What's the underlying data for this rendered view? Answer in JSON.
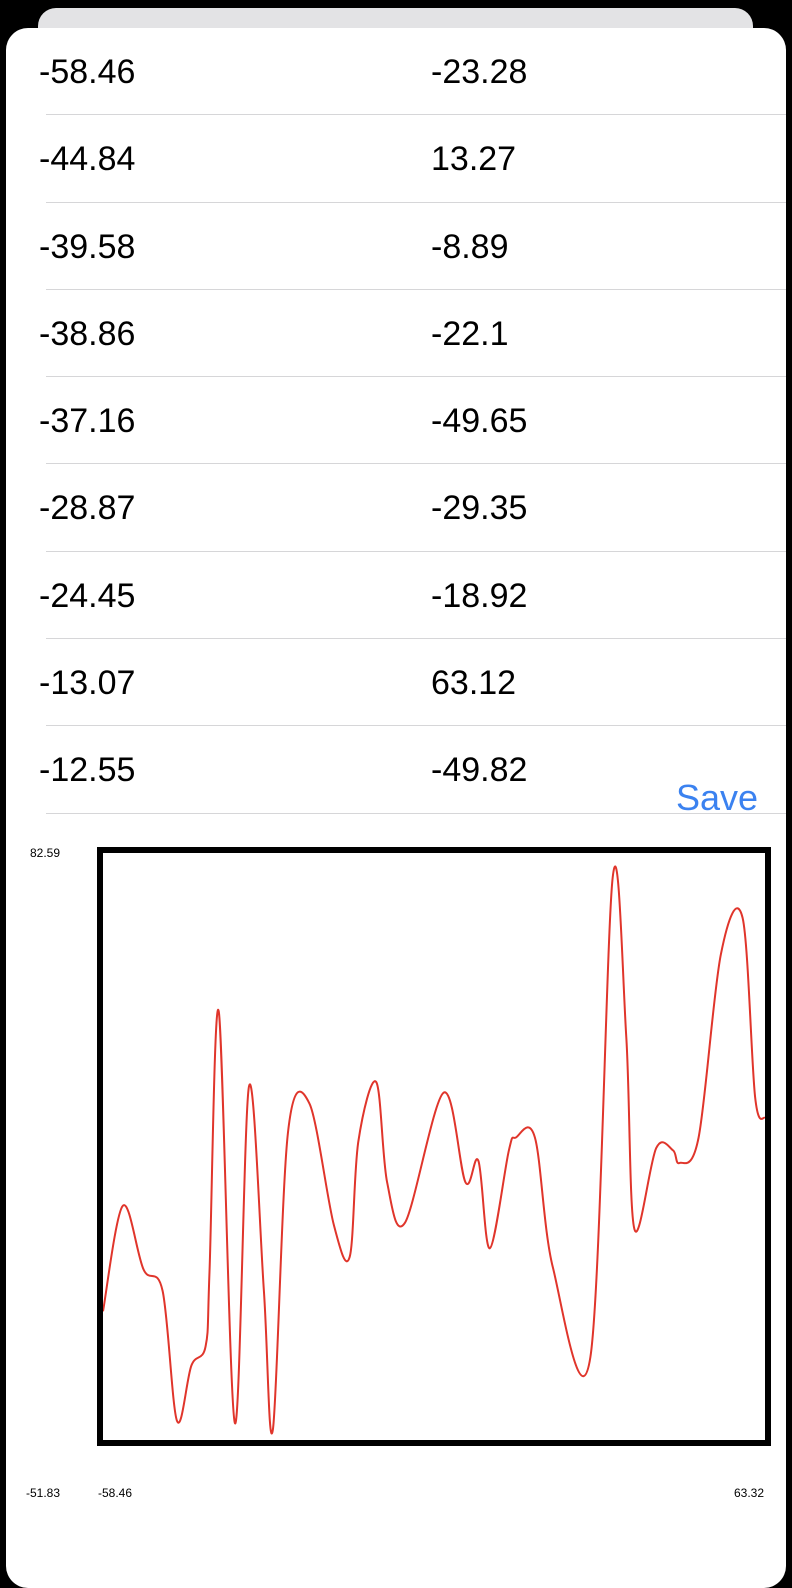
{
  "table": {
    "rows": [
      {
        "x": "-58.46",
        "y": "-23.28"
      },
      {
        "x": "-44.84",
        "y": "13.27"
      },
      {
        "x": "-39.58",
        "y": "-8.89"
      },
      {
        "x": "-38.86",
        "y": "-22.1"
      },
      {
        "x": "-37.16",
        "y": "-49.65"
      },
      {
        "x": "-28.87",
        "y": "-29.35"
      },
      {
        "x": "-24.45",
        "y": "-18.92"
      },
      {
        "x": "-13.07",
        "y": "63.12"
      },
      {
        "x": "-12.55",
        "y": "-49.82"
      }
    ]
  },
  "toolbar": {
    "save_label": "Save"
  },
  "colors": {
    "accent": "#3b82f0",
    "line": "#e0352b",
    "frame": "#000000"
  },
  "chart_data": {
    "type": "line",
    "y_max_label": "82.59",
    "y_min_label": "-51.83",
    "x_min_label": "-58.46",
    "x_max_label": "63.32",
    "xlim": [
      -58.46,
      63.32
    ],
    "ylim": [
      -51.83,
      82.59
    ],
    "x": [
      -58.46,
      -54.8,
      -51.0,
      -47.5,
      -44.84,
      -42.2,
      -39.58,
      -38.86,
      -37.16,
      -34.2,
      -31.6,
      -28.87,
      -27.2,
      -24.45,
      -20.5,
      -16.0,
      -13.07,
      -11.5,
      -8.2,
      -6.2,
      -2.9,
      4.2,
      8.2,
      10.6,
      12.7,
      16.2,
      17.5,
      21.0,
      24.3,
      31.2,
      35.3,
      37.8,
      39.3,
      43.3,
      46.4,
      47.6,
      51.1,
      55.2,
      59.2,
      61.5,
      63.32
    ],
    "y": [
      -23.28,
      1.5,
      -13.5,
      -18.5,
      -49.0,
      -36.0,
      -31.5,
      -14.0,
      47.0,
      -49.5,
      29.5,
      -18.5,
      -51.0,
      18.5,
      25.5,
      -3.0,
      -10.5,
      16.5,
      30.5,
      7.0,
      -2.5,
      28.0,
      7.0,
      12.0,
      -8.5,
      14.5,
      17.5,
      17.5,
      -13.0,
      -34.0,
      78.5,
      41.0,
      -4.0,
      15.0,
      14.5,
      11.5,
      17.5,
      60.5,
      69.0,
      27.0,
      22.0
    ]
  }
}
